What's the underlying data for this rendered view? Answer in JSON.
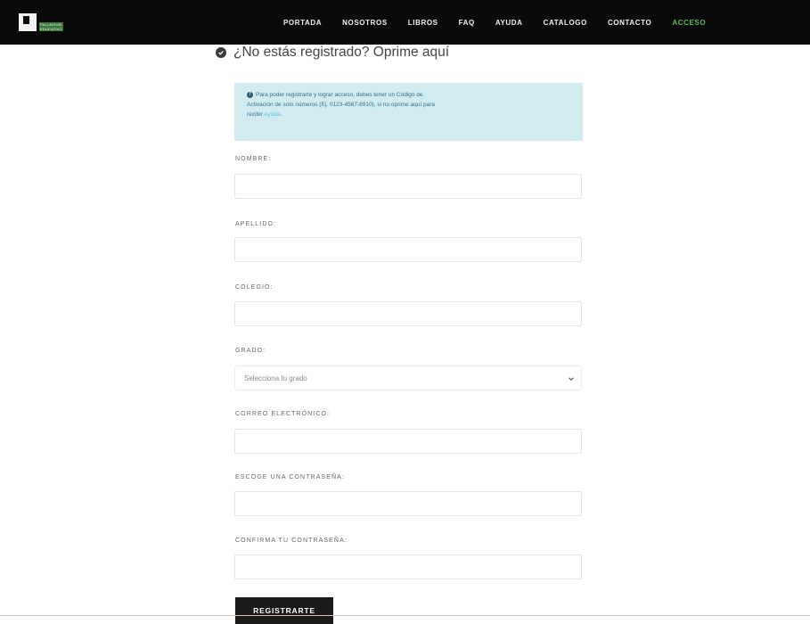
{
  "header": {
    "logo_lines": [
      "PALLADIUM",
      "EDUCATIVO"
    ],
    "nav": [
      "PORTADA",
      "NOSOTROS",
      "LIBROS",
      "FAQ",
      "AYUDA",
      "CATALOGO",
      "CONTACTO",
      "ACCESO"
    ],
    "active_color": "#5cb85c"
  },
  "section": {
    "title": "¿No estás registrado? Oprime aquí"
  },
  "alert": {
    "text_line1": "Para poder registrarte y lograr acceso, debes tener un Código de",
    "text_line2": "Activación de solo números (Ej. 0123-4567-8910), si no oprime aquí para",
    "text_line3": "recibir ",
    "link": "Ayuda"
  },
  "form": {
    "nombre_label": "NOMBRE:",
    "apellido_label": "APELLIDO:",
    "colegio_label": "COLEGIO:",
    "grado_label": "GRADO:",
    "grado_value": "Selecciona tu grado",
    "correo_label": "CORREO ELECTRÓNICO:",
    "password_label": "ESCOGE UNA CONTRASEÑA:",
    "confirm_label": "CONFIRMA TU CONTRASEÑA:",
    "submit_label": "REGISTRARTE"
  },
  "colors": {
    "navbar_bg": "#0a0a0a",
    "alert_bg": "#d1ecf1",
    "button_bg": "#1a1a1a"
  }
}
